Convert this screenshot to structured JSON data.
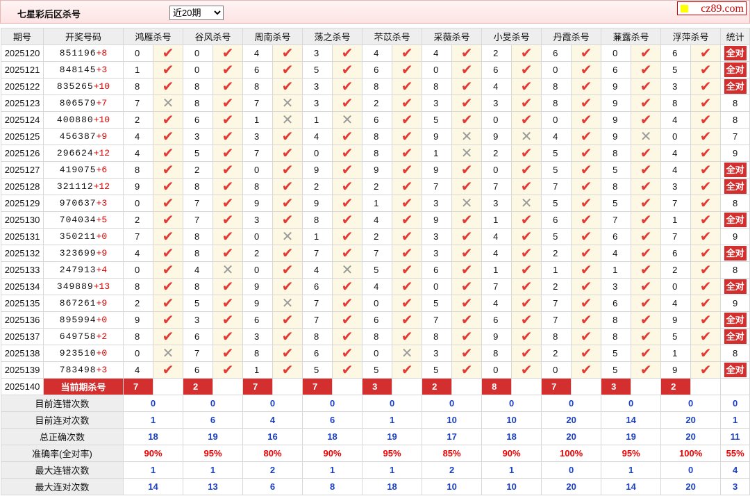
{
  "header": {
    "title": "七星彩后区杀号",
    "period_select": "近20期",
    "logo": "cz89.com"
  },
  "columns": [
    "期号",
    "开奖号码",
    "鸿雁杀号",
    "谷风杀号",
    "周南杀号",
    "荡之杀号",
    "芣苡杀号",
    "采薇杀号",
    "小旻杀号",
    "丹霞杀号",
    "蒹露杀号",
    "浮萍杀号",
    "统计"
  ],
  "rows": [
    {
      "issue": "2025120",
      "main": "851196",
      "bonus": "+8",
      "kills": [
        0,
        0,
        4,
        3,
        4,
        4,
        2,
        6,
        0,
        6
      ],
      "hits": [
        1,
        1,
        1,
        1,
        1,
        1,
        1,
        1,
        1,
        1
      ],
      "stat": "全对"
    },
    {
      "issue": "2025121",
      "main": "848145",
      "bonus": "+3",
      "kills": [
        1,
        0,
        6,
        5,
        6,
        0,
        6,
        0,
        6,
        5
      ],
      "hits": [
        1,
        1,
        1,
        1,
        1,
        1,
        1,
        1,
        1,
        1
      ],
      "stat": "全对"
    },
    {
      "issue": "2025122",
      "main": "835265",
      "bonus": "+10",
      "kills": [
        8,
        8,
        8,
        3,
        8,
        8,
        4,
        8,
        9,
        3
      ],
      "hits": [
        1,
        1,
        1,
        1,
        1,
        1,
        1,
        1,
        1,
        1
      ],
      "stat": "全对"
    },
    {
      "issue": "2025123",
      "main": "806579",
      "bonus": "+7",
      "kills": [
        7,
        8,
        7,
        3,
        2,
        3,
        3,
        8,
        9,
        8
      ],
      "hits": [
        0,
        1,
        0,
        1,
        1,
        1,
        1,
        1,
        1,
        1
      ],
      "stat": "8"
    },
    {
      "issue": "2025124",
      "main": "400880",
      "bonus": "+10",
      "kills": [
        2,
        6,
        1,
        1,
        6,
        5,
        0,
        0,
        9,
        4
      ],
      "hits": [
        1,
        1,
        0,
        0,
        1,
        1,
        1,
        1,
        1,
        1
      ],
      "stat": "8"
    },
    {
      "issue": "2025125",
      "main": "456387",
      "bonus": "+9",
      "kills": [
        4,
        3,
        3,
        4,
        8,
        9,
        9,
        4,
        9,
        0
      ],
      "hits": [
        1,
        1,
        1,
        1,
        1,
        0,
        0,
        1,
        0,
        1
      ],
      "stat": "7"
    },
    {
      "issue": "2025126",
      "main": "296624",
      "bonus": "+12",
      "kills": [
        4,
        5,
        7,
        0,
        8,
        1,
        2,
        5,
        8,
        4
      ],
      "hits": [
        1,
        1,
        1,
        1,
        1,
        0,
        1,
        1,
        1,
        1
      ],
      "stat": "9"
    },
    {
      "issue": "2025127",
      "main": "419075",
      "bonus": "+6",
      "kills": [
        8,
        2,
        0,
        9,
        9,
        9,
        0,
        5,
        5,
        4
      ],
      "hits": [
        1,
        1,
        1,
        1,
        1,
        1,
        1,
        1,
        1,
        1
      ],
      "stat": "全对"
    },
    {
      "issue": "2025128",
      "main": "321112",
      "bonus": "+12",
      "kills": [
        9,
        8,
        8,
        2,
        2,
        7,
        7,
        7,
        8,
        3
      ],
      "hits": [
        1,
        1,
        1,
        1,
        1,
        1,
        1,
        1,
        1,
        1
      ],
      "stat": "全对"
    },
    {
      "issue": "2025129",
      "main": "970637",
      "bonus": "+3",
      "kills": [
        0,
        7,
        9,
        9,
        1,
        3,
        3,
        5,
        5,
        7
      ],
      "hits": [
        1,
        1,
        1,
        1,
        1,
        0,
        0,
        1,
        1,
        1
      ],
      "stat": "8"
    },
    {
      "issue": "2025130",
      "main": "704034",
      "bonus": "+5",
      "kills": [
        2,
        7,
        3,
        8,
        4,
        9,
        1,
        6,
        7,
        1
      ],
      "hits": [
        1,
        1,
        1,
        1,
        1,
        1,
        1,
        1,
        1,
        1
      ],
      "stat": "全对"
    },
    {
      "issue": "2025131",
      "main": "350211",
      "bonus": "+0",
      "kills": [
        7,
        8,
        0,
        1,
        2,
        3,
        4,
        5,
        6,
        7
      ],
      "hits": [
        1,
        1,
        0,
        1,
        1,
        1,
        1,
        1,
        1,
        1
      ],
      "stat": "9"
    },
    {
      "issue": "2025132",
      "main": "323699",
      "bonus": "+9",
      "kills": [
        4,
        8,
        2,
        7,
        7,
        3,
        4,
        2,
        4,
        6
      ],
      "hits": [
        1,
        1,
        1,
        1,
        1,
        1,
        1,
        1,
        1,
        1
      ],
      "stat": "全对"
    },
    {
      "issue": "2025133",
      "main": "247913",
      "bonus": "+4",
      "kills": [
        0,
        4,
        0,
        4,
        5,
        6,
        1,
        1,
        1,
        2
      ],
      "hits": [
        1,
        0,
        1,
        0,
        1,
        1,
        1,
        1,
        1,
        1
      ],
      "stat": "8"
    },
    {
      "issue": "2025134",
      "main": "349889",
      "bonus": "+13",
      "kills": [
        8,
        8,
        9,
        6,
        4,
        0,
        7,
        2,
        3,
        0
      ],
      "hits": [
        1,
        1,
        1,
        1,
        1,
        1,
        1,
        1,
        1,
        1
      ],
      "stat": "全对"
    },
    {
      "issue": "2025135",
      "main": "867261",
      "bonus": "+9",
      "kills": [
        2,
        5,
        9,
        7,
        0,
        5,
        4,
        7,
        6,
        4
      ],
      "hits": [
        1,
        1,
        0,
        1,
        1,
        1,
        1,
        1,
        1,
        1
      ],
      "stat": "9"
    },
    {
      "issue": "2025136",
      "main": "895994",
      "bonus": "+0",
      "kills": [
        9,
        3,
        6,
        7,
        6,
        7,
        6,
        7,
        8,
        9
      ],
      "hits": [
        1,
        1,
        1,
        1,
        1,
        1,
        1,
        1,
        1,
        1
      ],
      "stat": "全对"
    },
    {
      "issue": "2025137",
      "main": "649758",
      "bonus": "+2",
      "kills": [
        8,
        6,
        3,
        8,
        8,
        8,
        9,
        8,
        8,
        5
      ],
      "hits": [
        1,
        1,
        1,
        1,
        1,
        1,
        1,
        1,
        1,
        1
      ],
      "stat": "全对"
    },
    {
      "issue": "2025138",
      "main": "923510",
      "bonus": "+0",
      "kills": [
        0,
        7,
        8,
        6,
        0,
        3,
        8,
        2,
        5,
        1
      ],
      "hits": [
        0,
        1,
        1,
        1,
        0,
        1,
        1,
        1,
        1,
        1
      ],
      "stat": "8"
    },
    {
      "issue": "2025139",
      "main": "783498",
      "bonus": "+3",
      "kills": [
        4,
        6,
        1,
        5,
        5,
        5,
        0,
        0,
        5,
        9
      ],
      "hits": [
        1,
        1,
        1,
        1,
        1,
        1,
        1,
        1,
        1,
        1
      ],
      "stat": "全对"
    }
  ],
  "current": {
    "issue": "2025140",
    "label": "当前期杀号",
    "kills": [
      7,
      2,
      7,
      7,
      3,
      2,
      8,
      7,
      3,
      2
    ]
  },
  "stats": [
    {
      "label": "目前连错次数",
      "values": [
        "0",
        "0",
        "0",
        "0",
        "0",
        "0",
        "0",
        "0",
        "0",
        "0",
        "0"
      ]
    },
    {
      "label": "目前连对次数",
      "values": [
        "1",
        "6",
        "4",
        "6",
        "1",
        "10",
        "10",
        "20",
        "14",
        "20",
        "1"
      ]
    },
    {
      "label": "总正确次数",
      "values": [
        "18",
        "19",
        "16",
        "18",
        "19",
        "17",
        "18",
        "20",
        "19",
        "20",
        "11"
      ]
    },
    {
      "label": "准确率(全对率)",
      "values": [
        "90%",
        "95%",
        "80%",
        "90%",
        "95%",
        "85%",
        "90%",
        "100%",
        "95%",
        "100%",
        "55%"
      ],
      "red": true
    },
    {
      "label": "最大连错次数",
      "values": [
        "1",
        "1",
        "2",
        "1",
        "1",
        "2",
        "1",
        "0",
        "1",
        "0",
        "4"
      ]
    },
    {
      "label": "最大连对次数",
      "values": [
        "14",
        "13",
        "6",
        "8",
        "18",
        "10",
        "10",
        "20",
        "14",
        "20",
        "3"
      ]
    }
  ],
  "icons": {
    "hit": "check-icon",
    "miss": "cross-icon"
  },
  "colors": {
    "accent_red": "#d32f2f",
    "check_red": "#e53935",
    "stat_blue": "#1a3fc4",
    "mark_bg": "#fdf8e4"
  }
}
